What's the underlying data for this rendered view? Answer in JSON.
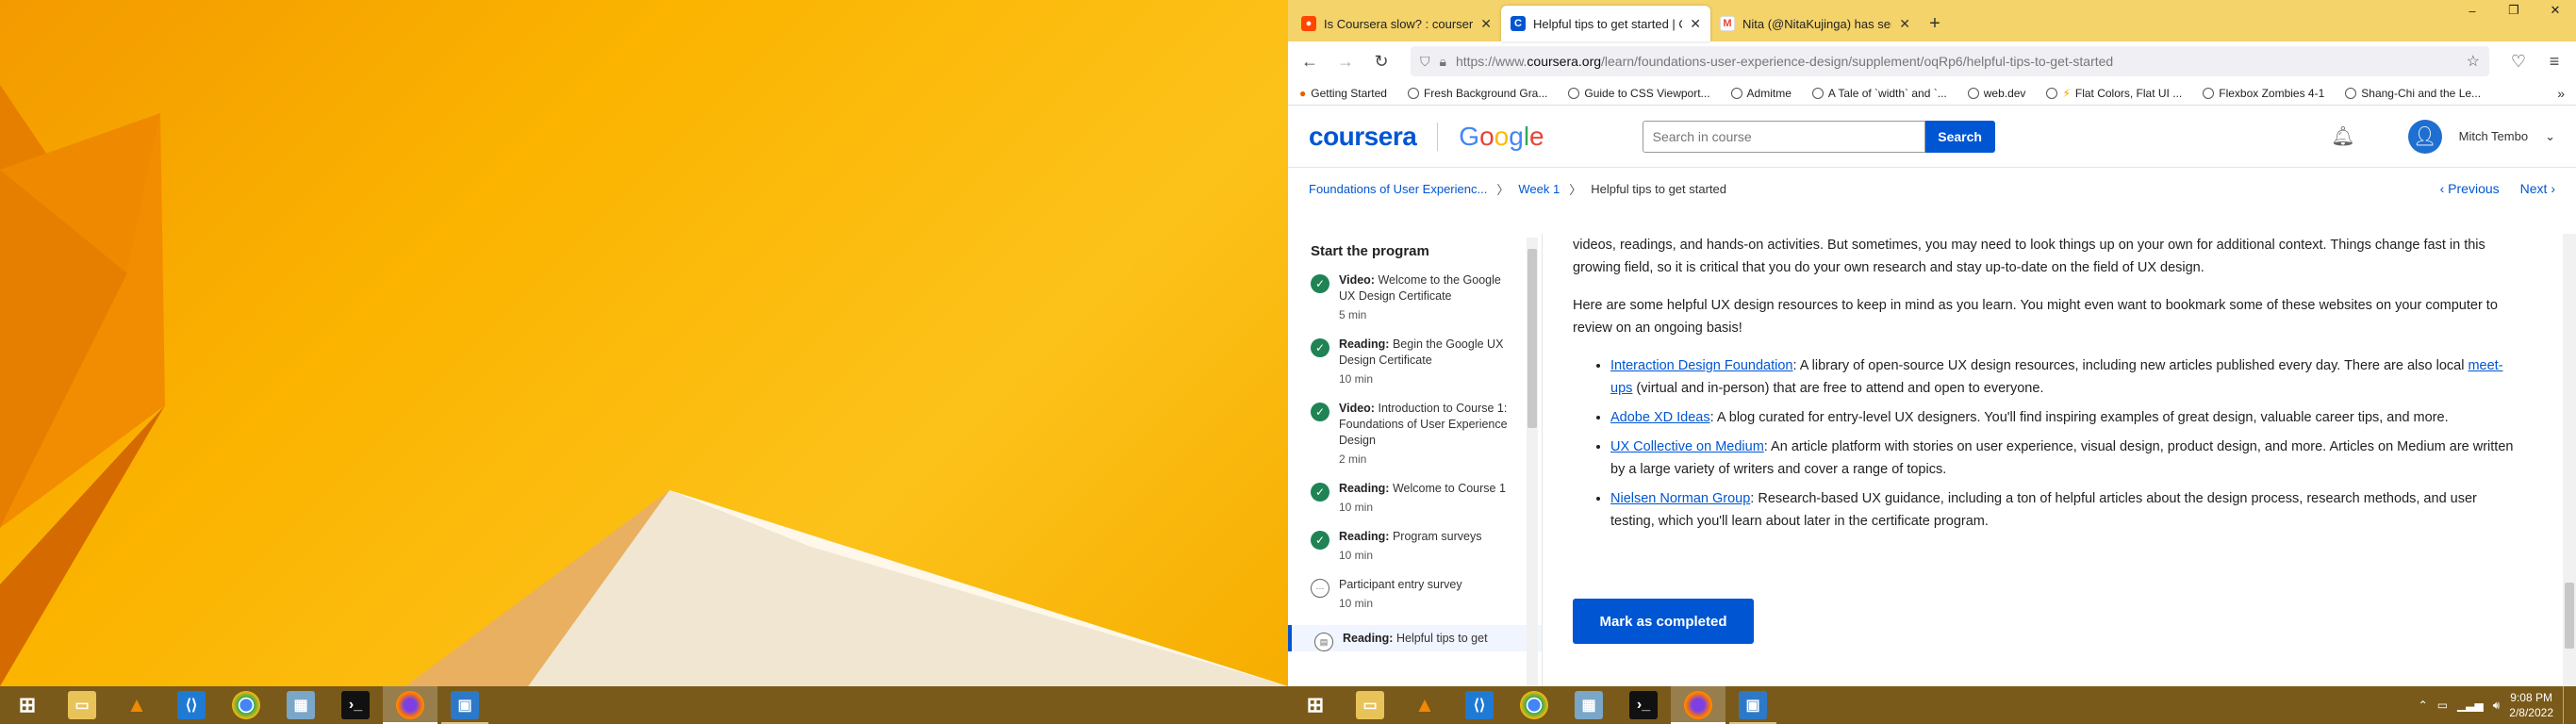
{
  "browser": {
    "tabs": [
      {
        "title": "Is Coursera slow? : coursera",
        "favicon": "reddit-icon",
        "color": "#ff4500"
      },
      {
        "title": "Helpful tips to get started | Cou",
        "favicon": "coursera-icon",
        "color": "#0056d2"
      },
      {
        "title": "Nita (@NitaKujinga) has sent yo",
        "favicon": "gmail-icon",
        "color": "#ea4335"
      }
    ],
    "window_controls": [
      "–",
      "❐",
      "✕"
    ],
    "url_prefix": "https://www.",
    "url_domain": "coursera.org",
    "url_path": "/learn/foundations-user-experience-design/supplement/oqRp6/helpful-tips-to-get-started",
    "bookmarks": [
      "Getting Started",
      "Fresh Background Gra...",
      "Guide to CSS Viewport...",
      "Admitme",
      "A Tale of `width` and `...",
      "web.dev",
      "Flat Colors, Flat UI ...",
      "Flexbox Zombies 4-1",
      "Shang-Chi and the Le..."
    ]
  },
  "site": {
    "logo": "coursera",
    "partner_logo": "Google",
    "search_placeholder": "Search in course",
    "search_button": "Search",
    "user_name": "Mitch Tembo"
  },
  "breadcrumb": {
    "course": "Foundations of User Experienc...",
    "week": "Week 1",
    "current": "Helpful tips to get started",
    "previous": "Previous",
    "next": "Next"
  },
  "sidebar": {
    "title": "Start the program",
    "items": [
      {
        "type": "Video:",
        "title": "Welcome to the Google UX Design Certificate",
        "duration": "5 min",
        "status": "done"
      },
      {
        "type": "Reading:",
        "title": "Begin the Google UX Design Certificate",
        "duration": "10 min",
        "status": "done"
      },
      {
        "type": "Video:",
        "title": "Introduction to Course 1: Foundations of User Experience Design",
        "duration": "2 min",
        "status": "done"
      },
      {
        "type": "Reading:",
        "title": "Welcome to Course 1",
        "duration": "10 min",
        "status": "done"
      },
      {
        "type": "Reading:",
        "title": "Program surveys",
        "duration": "10 min",
        "status": "done"
      },
      {
        "type": "",
        "title": "Participant entry survey",
        "duration": "10 min",
        "status": "todo"
      },
      {
        "type": "Reading:",
        "title": "Helpful tips to get",
        "duration": "",
        "status": "current"
      }
    ]
  },
  "article": {
    "para1": "videos, readings, and hands-on activities. But sometimes, you may need to look things up on your own for additional context. Things change fast in this growing field, so it is critical that you do your own research and stay up-to-date on the field of UX design.",
    "para2": "Here are some helpful UX design resources to keep in mind as you learn. You might even want to bookmark some of these websites on your computer to review on an ongoing basis!",
    "resources": [
      {
        "link": "Interaction Design Foundation",
        "text_a": ": A library of open-source UX design resources, including new articles published every day. There are also local ",
        "link2": "meet-ups",
        "text_b": " (virtual and in-person) that are free to attend and open to everyone."
      },
      {
        "link": "Adobe XD Ideas",
        "text_a": ": A blog curated for entry-level UX designers. You'll find inspiring examples of great design, valuable career tips, and more.",
        "link2": "",
        "text_b": ""
      },
      {
        "link": "UX Collective on Medium",
        "text_a": ": An article platform with stories on user experience, visual design, product design, and more. Articles on Medium are written by a large variety of writers and cover a range of topics.",
        "link2": "",
        "text_b": ""
      },
      {
        "link": "Nielsen Norman Group",
        "text_a": ": Research-based UX guidance, including a ton of helpful articles about the design process, research methods, and user testing, which you'll learn about later in the certificate program.",
        "link2": "",
        "text_b": ""
      }
    ],
    "complete_button": "Mark as completed"
  },
  "taskbar": {
    "apps": [
      "start-icon",
      "file-explorer-icon",
      "vlc-icon",
      "vscode-icon",
      "chrome-icon",
      "photos-icon",
      "terminal-icon",
      "firefox-icon",
      "remote-desktop-icon"
    ],
    "time": "9:08 PM",
    "date": "2/8/2022"
  }
}
